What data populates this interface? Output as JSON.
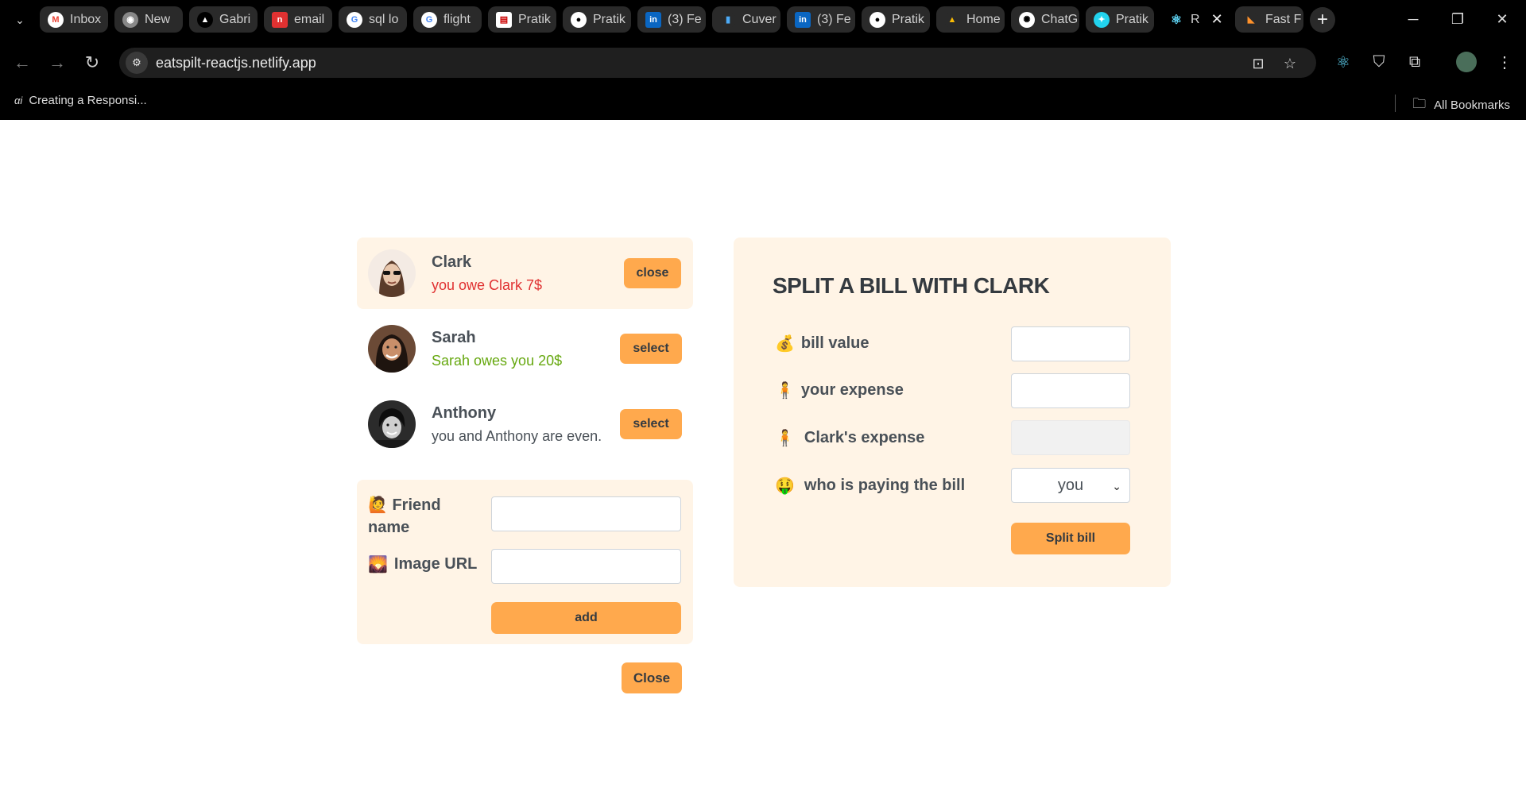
{
  "browser": {
    "tabs": [
      {
        "label": "Inbox",
        "icon": "gmail-icon"
      },
      {
        "label": "New",
        "icon": "chrome-icon"
      },
      {
        "label": "Gabri",
        "icon": "triangle-icon"
      },
      {
        "label": "email",
        "icon": "n-icon"
      },
      {
        "label": "sql lo",
        "icon": "google-icon"
      },
      {
        "label": "flight",
        "icon": "google-icon"
      },
      {
        "label": "Pratik",
        "icon": "doc-icon"
      },
      {
        "label": "Pratik",
        "icon": "github-icon"
      },
      {
        "label": "(3) Fe",
        "icon": "linkedin-icon"
      },
      {
        "label": "Cuver",
        "icon": "cup-icon"
      },
      {
        "label": "(3) Fe",
        "icon": "linkedin-icon"
      },
      {
        "label": "Pratik",
        "icon": "github-icon"
      },
      {
        "label": "Home",
        "icon": "drive-icon"
      },
      {
        "label": "ChatG",
        "icon": "openai-icon"
      },
      {
        "label": "Pratik",
        "icon": "gear-icon"
      },
      {
        "label": "R",
        "icon": "react-icon"
      },
      {
        "label": "Fast F",
        "icon": "pizza-icon"
      }
    ],
    "url": "eatspilt-reactjs.netlify.app",
    "bookmark": "Creating a Responsi...",
    "all_bookmarks": "All Bookmarks"
  },
  "friends": [
    {
      "name": "Clark",
      "status": "you owe Clark 7$",
      "status_color": "#e03131",
      "button": "close",
      "selected": true
    },
    {
      "name": "Sarah",
      "status": "Sarah owes you 20$",
      "status_color": "#66a80f",
      "button": "select",
      "selected": false
    },
    {
      "name": "Anthony",
      "status": "you and Anthony are even.",
      "status_color": "#495057",
      "button": "select",
      "selected": false
    }
  ],
  "add_friend": {
    "name_label": "Friend name",
    "name_emoji": "🙋",
    "image_label": "Image URL",
    "image_emoji": "🌄",
    "add_button": "add"
  },
  "close_button": "Close",
  "split": {
    "title": "SPLIT A BILL WITH CLARK",
    "bill_label": "bill value",
    "bill_emoji": "💰",
    "your_label": "your expense",
    "your_emoji": "🧍",
    "friend_label": "Clark's expense",
    "friend_emoji": "🧍",
    "payer_label": "who is paying the bill",
    "payer_emoji": "🤑",
    "payer_value": "you",
    "split_button": "Split bill"
  },
  "colors": {
    "accent": "#ffa94d",
    "panel": "#fff4e6",
    "text": "#495057",
    "owe": "#e03131",
    "owed": "#66a80f"
  }
}
